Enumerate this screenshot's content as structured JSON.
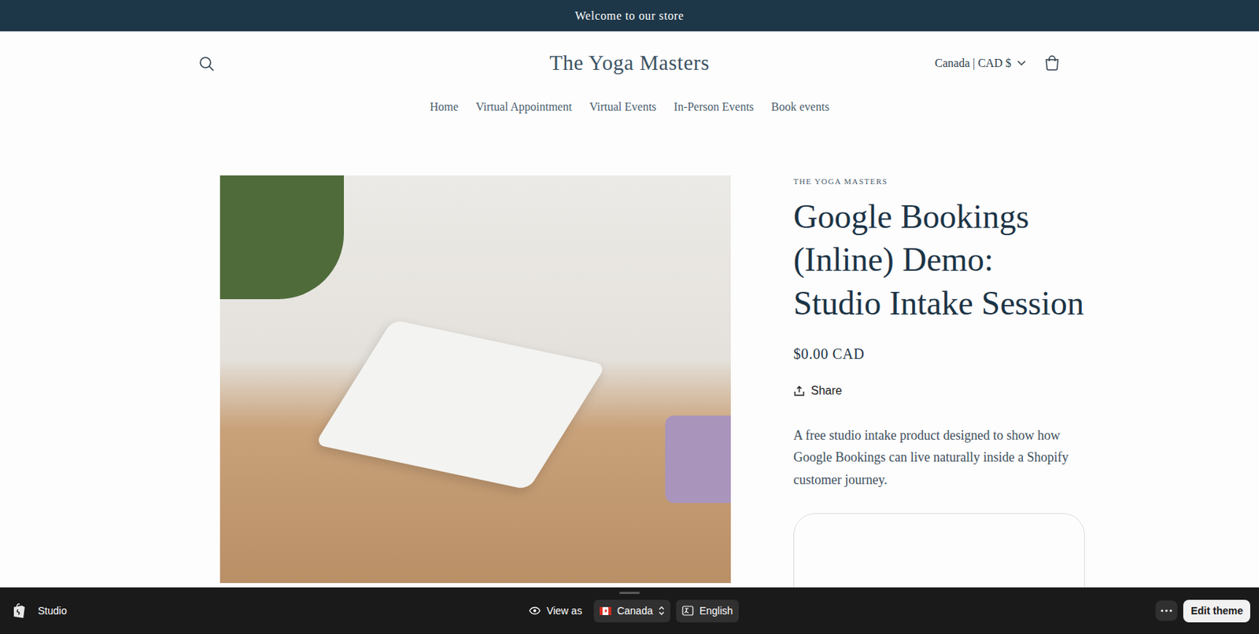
{
  "announcement": "Welcome to our store",
  "header": {
    "logo": "The Yoga Masters",
    "locale": "Canada | CAD $"
  },
  "nav": [
    {
      "label": "Home"
    },
    {
      "label": "Virtual Appointment"
    },
    {
      "label": "Virtual Events"
    },
    {
      "label": "In-Person Events"
    },
    {
      "label": "Book events"
    }
  ],
  "product": {
    "vendor": "THE YOGA MASTERS",
    "title": "Google Bookings (Inline) Demo: Studio Intake Session",
    "price": "$0.00 CAD",
    "share": "Share",
    "description": "A free studio intake product designed to show how Google Bookings can live naturally inside a Shopify customer journey."
  },
  "preview_bar": {
    "app": "Studio",
    "view_as": "View as",
    "country": "Canada",
    "language": "English",
    "edit": "Edit theme"
  }
}
